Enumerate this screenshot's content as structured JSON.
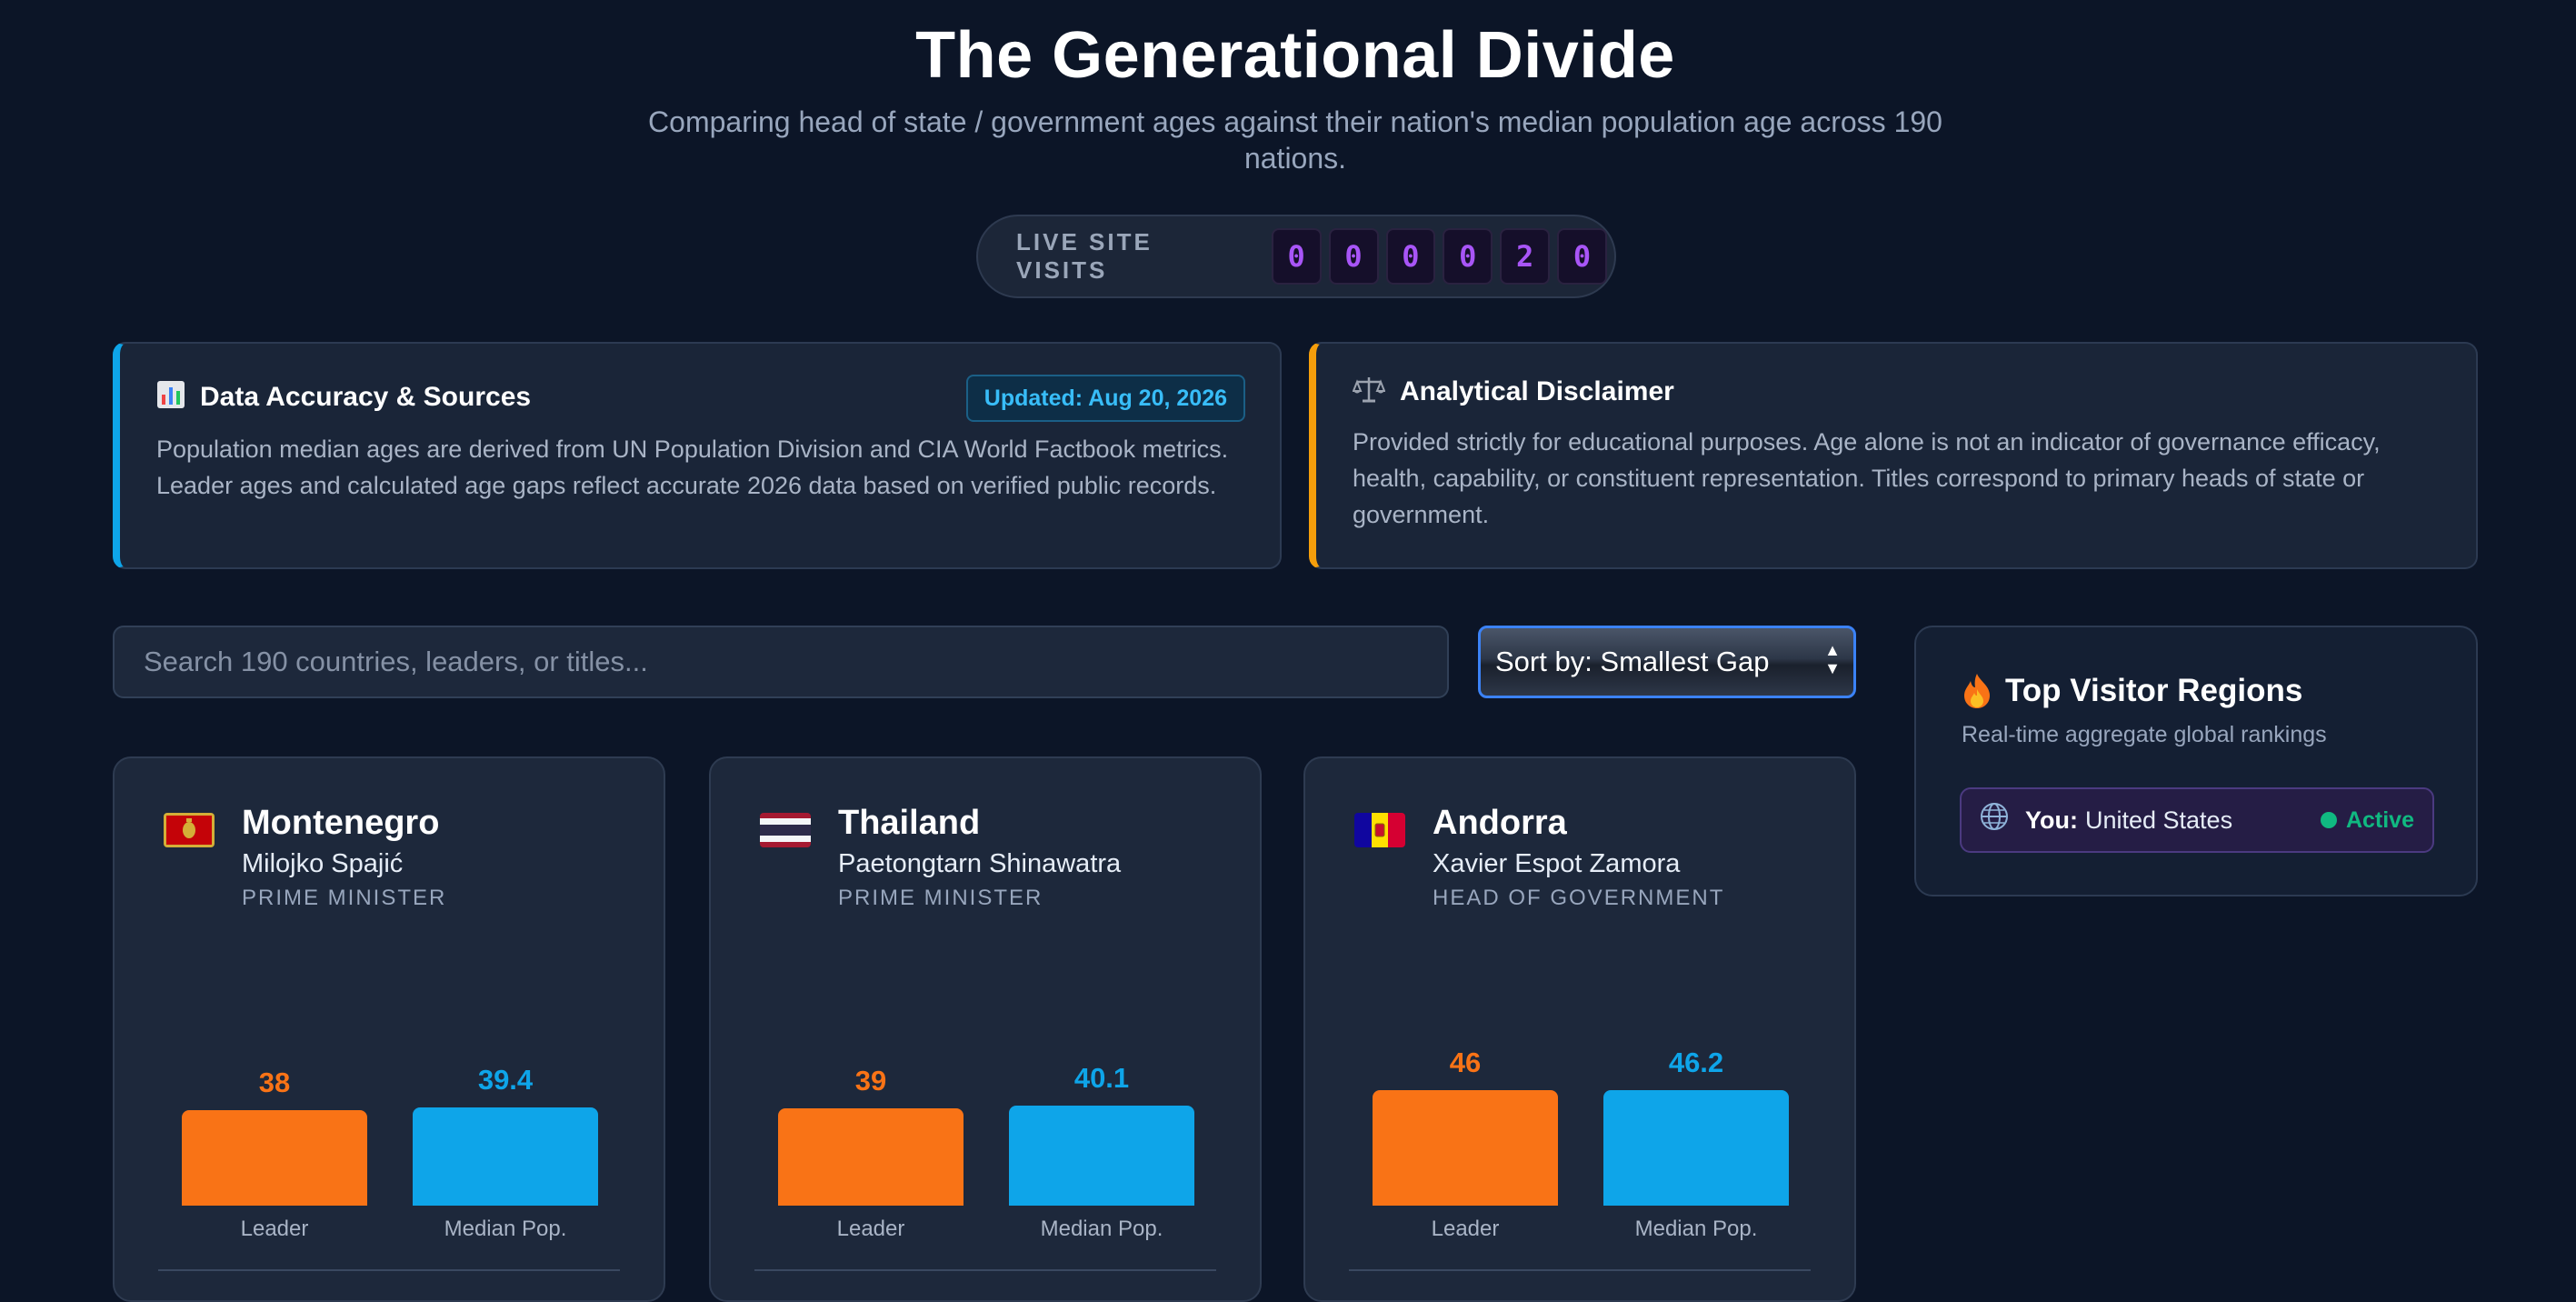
{
  "header": {
    "title": "The Generational Divide",
    "subtitle": "Comparing head of state / government ages against their nation's median population age across 190 nations."
  },
  "visits": {
    "label": "LIVE SITE VISITS",
    "digits": [
      "0",
      "0",
      "0",
      "0",
      "2",
      "0"
    ]
  },
  "sources_card": {
    "icon": "bar-chart-icon",
    "title": "Data Accuracy & Sources",
    "badge": "Updated: Aug 20, 2026",
    "text": "Population median ages are derived from UN Population Division and CIA World Factbook metrics. Leader ages and calculated age gaps reflect accurate 2026 data based on verified public records."
  },
  "disclaimer_card": {
    "icon": "scales-icon",
    "title": "Analytical Disclaimer",
    "text": "Provided strictly for educational purposes. Age alone is not an indicator of governance efficacy, health, capability, or constituent representation. Titles correspond to primary heads of state or government."
  },
  "controls": {
    "search_placeholder": "Search 190 countries, leaders, or titles...",
    "sort_label": "Sort by: Smallest Gap"
  },
  "cards": [
    {
      "country": "Montenegro",
      "leader": "Milojko Spajić",
      "title": "PRIME MINISTER",
      "leader_age": "38",
      "median_age": "39.4",
      "leader_caption": "Leader",
      "median_caption": "Median Pop."
    },
    {
      "country": "Thailand",
      "leader": "Paetongtarn Shinawatra",
      "title": "PRIME MINISTER",
      "leader_age": "39",
      "median_age": "40.1",
      "leader_caption": "Leader",
      "median_caption": "Median Pop."
    },
    {
      "country": "Andorra",
      "leader": "Xavier Espot Zamora",
      "title": "HEAD OF GOVERNMENT",
      "leader_age": "46",
      "median_age": "46.2",
      "leader_caption": "Leader",
      "median_caption": "Median Pop."
    }
  ],
  "regions": {
    "icon": "fire-icon",
    "title": "Top Visitor Regions",
    "subtitle": "Real-time aggregate global rankings",
    "you_label": "You:",
    "you_country": "United States",
    "status": "Active"
  },
  "colors": {
    "leader_bar": "#f97316",
    "median_bar": "#0ea5e9",
    "counter_digit": "#a855f7",
    "active_status": "#10b981"
  }
}
